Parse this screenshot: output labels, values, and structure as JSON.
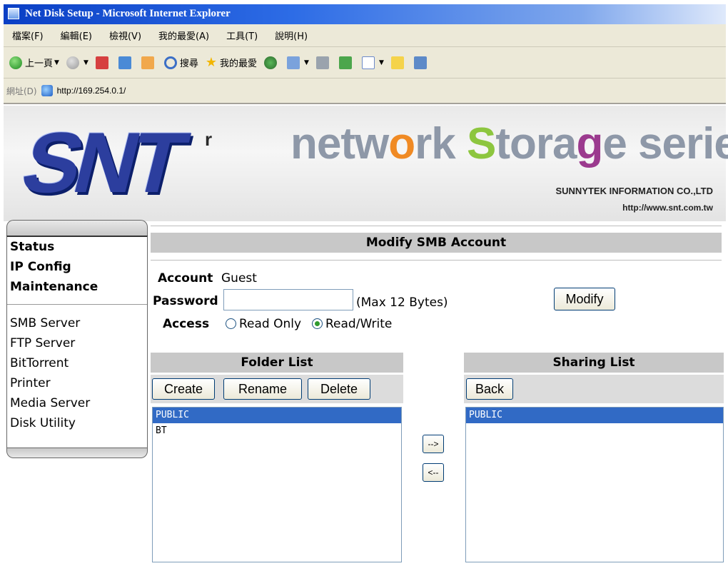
{
  "window": {
    "title": "Net Disk Setup - Microsoft Internet Explorer"
  },
  "menu": [
    "檔案(F)",
    "編輯(E)",
    "檢視(V)",
    "我的最愛(A)",
    "工具(T)",
    "說明(H)"
  ],
  "toolbar": {
    "back_label": "上一頁",
    "search_label": "搜尋",
    "favorites_label": "我的最愛"
  },
  "address": {
    "label": "網址(D)",
    "url": "http://169.254.0.1/"
  },
  "banner": {
    "logo": "SNT",
    "logo_mark": "r",
    "series": {
      "part1": "netw",
      "o": "o",
      "part2": "rk ",
      "s": "S",
      "part3": "tora",
      "g": "g",
      "part4": "e series"
    },
    "company": "SUNNYTEK INFORMATION CO.,LTD",
    "website": "http://www.snt.com.tw"
  },
  "sidebar": {
    "group1": [
      "Status",
      "IP Config",
      "Maintenance"
    ],
    "group2": [
      "SMB Server",
      "FTP Server",
      "BitTorrent",
      "Printer",
      "Media Server",
      "Disk Utility"
    ]
  },
  "form": {
    "header": "Modify SMB Account",
    "account_label": "Account",
    "account_value": "Guest",
    "password_label": "Password",
    "password_value": "",
    "password_hint": "(Max 12 Bytes)",
    "access_label": "Access",
    "access_options": [
      "Read Only",
      "Read/Write"
    ],
    "access_selected": "Read/Write",
    "modify_button": "Modify"
  },
  "folder_list": {
    "header": "Folder List",
    "buttons": [
      "Create",
      "Rename",
      "Delete"
    ],
    "items": [
      "PUBLIC",
      "BT"
    ],
    "selected": "PUBLIC"
  },
  "transfer": {
    "add": "-->",
    "remove": "<--"
  },
  "sharing_list": {
    "header": "Sharing List",
    "back_button": "Back",
    "items": [
      "PUBLIC"
    ],
    "selected": "PUBLIC"
  }
}
